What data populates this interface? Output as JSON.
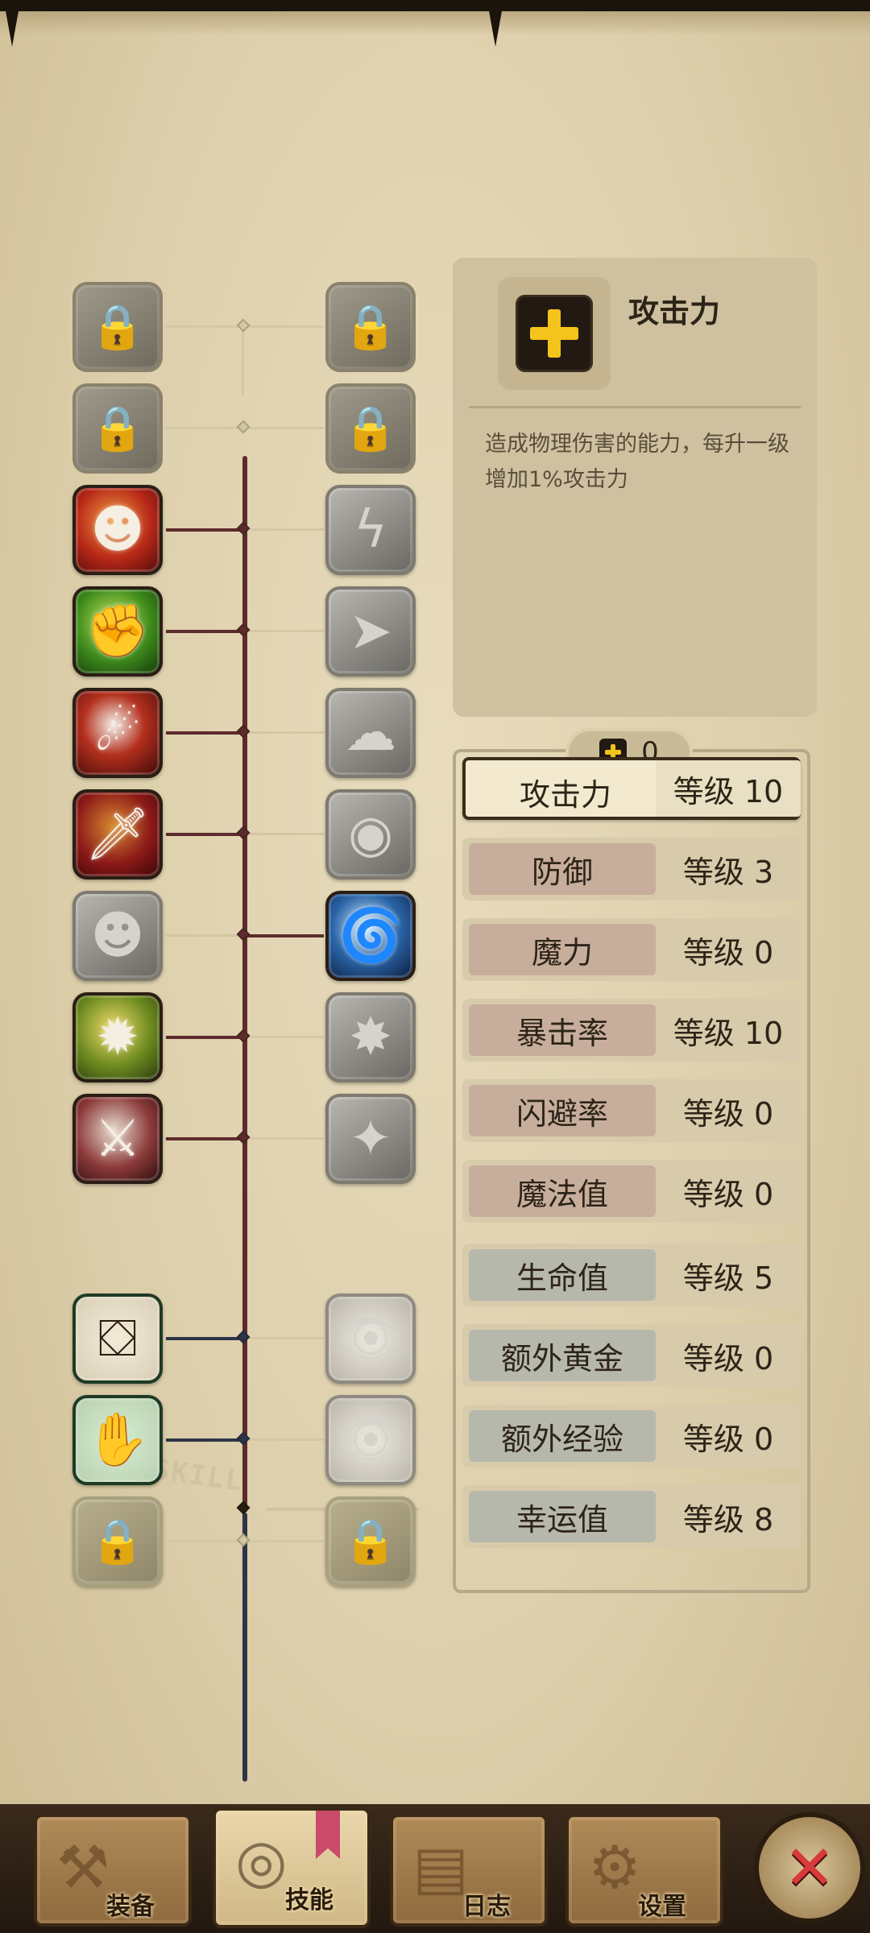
{
  "info_panel": {
    "title": "攻击力",
    "icon": "plus-icon",
    "description": "造成物理伤害的能力，每升一级增加1%攻击力"
  },
  "points": {
    "icon": "plus-icon",
    "value": "0"
  },
  "stats": [
    {
      "name": "攻击力",
      "level": "等级 10",
      "selected": true,
      "group": "combat"
    },
    {
      "name": "防御",
      "level": "等级 3",
      "group": "combat"
    },
    {
      "name": "魔力",
      "level": "等级 0",
      "group": "combat"
    },
    {
      "name": "暴击率",
      "level": "等级 10",
      "group": "combat"
    },
    {
      "name": "闪避率",
      "level": "等级 0",
      "group": "combat"
    },
    {
      "name": "魔法值",
      "level": "等级 0",
      "group": "combat"
    },
    {
      "name": "生命值",
      "level": "等级 5",
      "group": "resource"
    },
    {
      "name": "额外黄金",
      "level": "等级 0",
      "group": "resource"
    },
    {
      "name": "额外经验",
      "level": "等级 0",
      "group": "resource"
    },
    {
      "name": "幸运值",
      "level": "等级 8",
      "group": "resource"
    }
  ],
  "skill_tree": {
    "section_label": "SKILL",
    "left_column": [
      {
        "icon": "locked-skill-icon",
        "state": "locked"
      },
      {
        "icon": "locked-skill-icon",
        "state": "locked"
      },
      {
        "icon": "rage-face-skill-icon",
        "state": "unlocked"
      },
      {
        "icon": "flex-arm-skill-icon",
        "state": "unlocked"
      },
      {
        "icon": "dash-strike-skill-icon",
        "state": "unlocked"
      },
      {
        "icon": "dagger-skill-icon",
        "state": "unlocked"
      },
      {
        "icon": "shadow-skill-icon",
        "state": "inactive"
      },
      {
        "icon": "berserk-skill-icon",
        "state": "unlocked"
      },
      {
        "icon": "sword-skill-icon",
        "state": "unlocked"
      },
      {
        "icon": "loot-chest-skill-icon",
        "state": "unlocked"
      },
      {
        "icon": "grab-chest-skill-icon",
        "state": "unlocked"
      },
      {
        "icon": "locked-relic-icon",
        "state": "locked"
      }
    ],
    "right_column": [
      {
        "icon": "locked-skill-icon",
        "state": "locked"
      },
      {
        "icon": "locked-skill-icon",
        "state": "locked"
      },
      {
        "icon": "lightning-skill-icon",
        "state": "inactive"
      },
      {
        "icon": "charge-skill-icon",
        "state": "inactive"
      },
      {
        "icon": "smoke-skill-icon",
        "state": "inactive"
      },
      {
        "icon": "eye-skill-icon",
        "state": "inactive"
      },
      {
        "icon": "whirlwind-slash-skill-icon",
        "state": "unlocked"
      },
      {
        "icon": "explosion-skill-icon",
        "state": "inactive"
      },
      {
        "icon": "sparkle-skill-icon",
        "state": "inactive"
      },
      {
        "icon": "eye-chest-skill-icon",
        "state": "inactive"
      },
      {
        "icon": "eye-chest-skill-icon",
        "state": "inactive"
      },
      {
        "icon": "locked-relic-icon",
        "state": "locked"
      }
    ]
  },
  "tabs": [
    {
      "label": "装备",
      "icon": "axe-icon",
      "active": false
    },
    {
      "label": "技能",
      "icon": "gear-ring-icon",
      "active": true
    },
    {
      "label": "日志",
      "icon": "scroll-icon",
      "active": false
    },
    {
      "label": "设置",
      "icon": "gear-icon",
      "active": false
    }
  ],
  "close_button": {
    "icon": "close-icon"
  },
  "colors": {
    "parchment": "#ddcfab",
    "trunk_upper": "#5c2c2c",
    "trunk_lower": "#2e3448",
    "accent_gold": "#f5c41c",
    "close_red": "#d83a3a"
  }
}
